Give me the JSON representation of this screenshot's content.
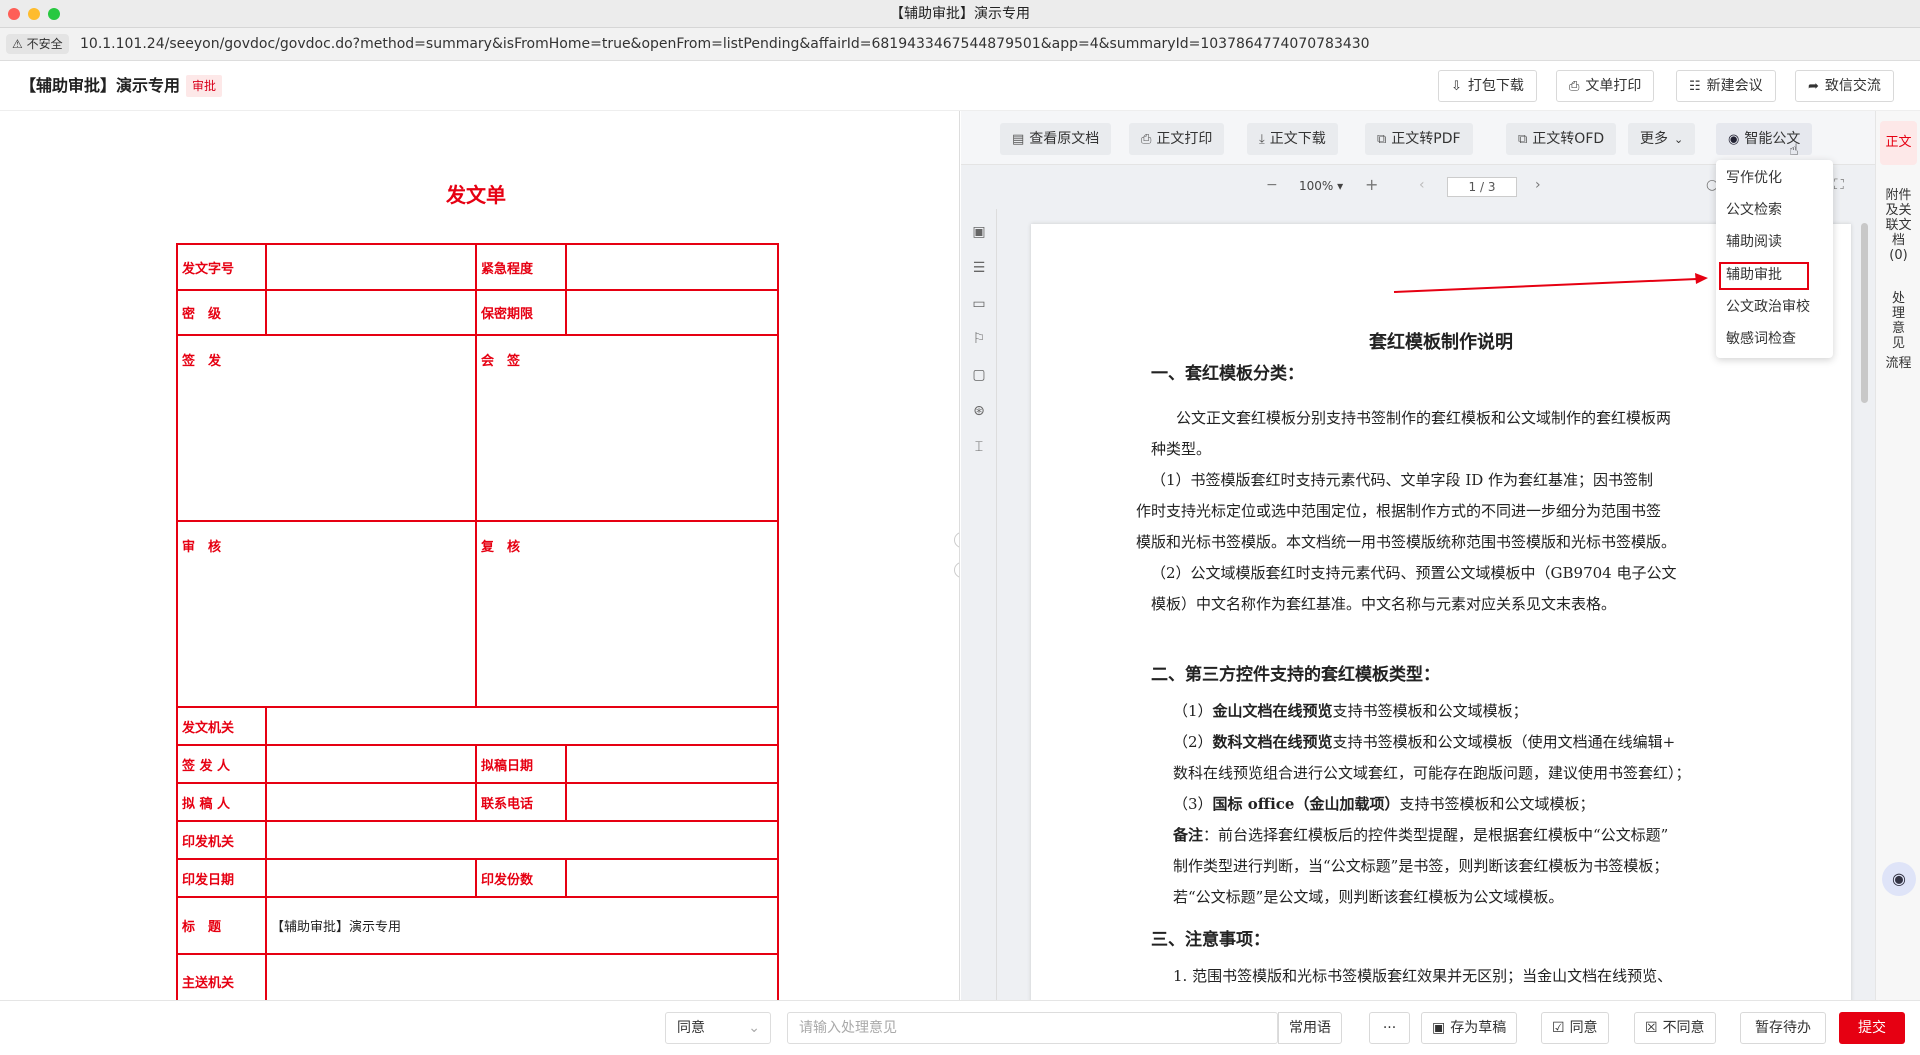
{
  "window": {
    "title": "【辅助审批】演示专用"
  },
  "address_bar": {
    "insecure_label": "不安全",
    "url": "10.1.101.24/seeyon/govdoc/govdoc.do?method=summary&isFromHome=true&openFrom=listPending&affairId=6819433467544879501&app=4&summaryId=1037864774070783430"
  },
  "header": {
    "title": "【辅助审批】演示专用",
    "badge": "审批",
    "buttons": {
      "pack_download": "打包下载",
      "doc_print": "文单打印",
      "new_meeting": "新建会议",
      "message": "致信交流"
    }
  },
  "form": {
    "title": "发文单",
    "labels": {
      "doc_no": "发文字号",
      "urgency": "紧急程度",
      "secret_level": "密　级",
      "secret_period": "保密期限",
      "sign": "签　发",
      "countersign": "会　签",
      "review": "审　核",
      "recheck": "复　核",
      "issuing_org": "发文机关",
      "signer": "签 发 人",
      "draft_date": "拟稿日期",
      "drafter": "拟 稿 人",
      "phone": "联系电话",
      "print_org": "印发机关",
      "print_date": "印发日期",
      "print_copies": "印发份数",
      "subject": "标　题",
      "main_recipient": "主送机关"
    },
    "values": {
      "subject": "【辅助审批】演示专用"
    }
  },
  "right_toolbar": {
    "view_original": "查看原文档",
    "body_print": "正文打印",
    "body_download": "正文下载",
    "to_pdf": "正文转PDF",
    "to_ofd": "正文转OFD",
    "more": "更多",
    "smart_doc": "智能公文"
  },
  "viewer": {
    "zoom": "100%",
    "page": "1 / 3"
  },
  "smart_menu": {
    "items": [
      "写作优化",
      "公文检索",
      "辅助阅读",
      "辅助审批",
      "公文政治审校",
      "敏感词检查"
    ],
    "highlighted": "辅助审批"
  },
  "document": {
    "heading": "套红模板制作说明",
    "sec1": "一、套红模板分类：",
    "p1a": "公文正文套红模板分别支持书签制作的套红模板和公文域制作的套红模板两",
    "p1b": "种类型。",
    "p2a": "（1）书签模版套红时支持元素代码、文单字段 ID 作为套红基准；因书签制",
    "p2b": "作时支持光标定位或选中范围定位，根据制作方式的不同进一步细分为范围书签",
    "p2c": "模版和光标书签模版。本文档统一用书签模版统称范围书签模版和光标书签模版。",
    "p3a": "（2）公文域模版套红时支持元素代码、预置公文域模板中（GB9704 电子公文",
    "p3b": "模板）中文名称作为套红基准。中文名称与元素对应关系见文末表格。",
    "sec2": "二、第三方控件支持的套红模板类型：",
    "l1_pre": "（1）",
    "l1_bold": "金山文档在线预览",
    "l1_post": "支持书签模板和公文域模板；",
    "l2_pre": "（2）",
    "l2_bold": "数科文档在线预览",
    "l2_post": "支持书签模板和公文域模板（使用文档通在线编辑+",
    "l2b": "数科在线预览组合进行公文域套红，可能存在跑版问题，建议使用书签套红）；",
    "l3_pre": "（3）",
    "l3_bold": "国标 office（金山加载项）",
    "l3_post": "支持书签模板和公文域模板；",
    "note_bold": "备注",
    "note_post": "：前台选择套红模板后的控件类型提醒，是根据套红模板中“公文标题”",
    "note_b": "制作类型进行判断，当“公文标题”是书签，则判断该套红模板为书签模板；",
    "note_c": "若“公文标题”是公文域，则判断该套红模板为公文域模板。",
    "sec3": "三、注意事项：",
    "p4": "1. 范围书签模版和光标书签模版套红效果并无区别；当金山文档在线预览、"
  },
  "right_tabs": {
    "body": "正文",
    "attachments": "附件及关联文档(0)",
    "opinion": "处理意见",
    "flow": "流程"
  },
  "bottom_bar": {
    "attitude": "同意",
    "opinion_placeholder": "请输入处理意见",
    "common_phrases": "常用语",
    "more": "···",
    "save_draft": "存为草稿",
    "agree": "同意",
    "disagree": "不同意",
    "hold": "暂存待办",
    "submit": "提交"
  },
  "colors": {
    "accent": "#e60012",
    "form_red": "#e60012"
  }
}
